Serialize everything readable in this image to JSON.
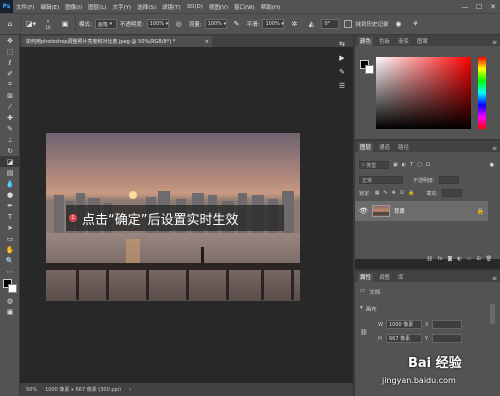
{
  "menubar": {
    "items": [
      "文件(F)",
      "编辑(E)",
      "图像(I)",
      "图层(L)",
      "文字(Y)",
      "选择(S)",
      "滤镜(T)",
      "3D(D)",
      "视图(V)",
      "窗口(W)",
      "帮助(H)"
    ],
    "minimize": "—",
    "maximize": "☐",
    "close": "✕"
  },
  "options": {
    "brush_size": "10",
    "mode_label": "模式:",
    "mode_value": "画笔",
    "opacity_label": "不透明度:",
    "opacity_value": "100%",
    "flow_label": "流量:",
    "flow_value": "100%",
    "smooth_label": "平滑:",
    "smooth_value": "100%",
    "angle_value": "0°",
    "erase_history_label": "抹到历史记录"
  },
  "document": {
    "tab_title": "如何用photoshop调整照片亮度和对比度.jpeg @ 50%(RGB/8*) *",
    "tab_close": "×",
    "callout_number": "1",
    "callout_text": "点击“确定”后设置实时生效"
  },
  "status": {
    "zoom": "50%",
    "doc_info": "1000 像素 x 667 像素 (300 ppi)"
  },
  "color_panel": {
    "tabs": [
      "颜色",
      "色板",
      "渐变",
      "图案"
    ]
  },
  "layers_panel": {
    "tabs": [
      "图层",
      "通道",
      "路径"
    ],
    "filter_kind": "类型",
    "blend_mode": "正常",
    "opacity_label": "不透明度:",
    "lock_label": "锁定:",
    "fill_label": "填充:",
    "layer_name": "背景"
  },
  "properties_panel": {
    "tabs": [
      "属性",
      "调整",
      "库"
    ],
    "doc_label": "文档",
    "canvas_label": "画布",
    "w_label": "W",
    "w_value": "1000 像素",
    "h_label": "H",
    "h_value": "667 像素",
    "x_label": "X",
    "y_label": "Y"
  },
  "watermark": {
    "brand": "Bai 经验",
    "url": "jingyan.baidu.com"
  }
}
